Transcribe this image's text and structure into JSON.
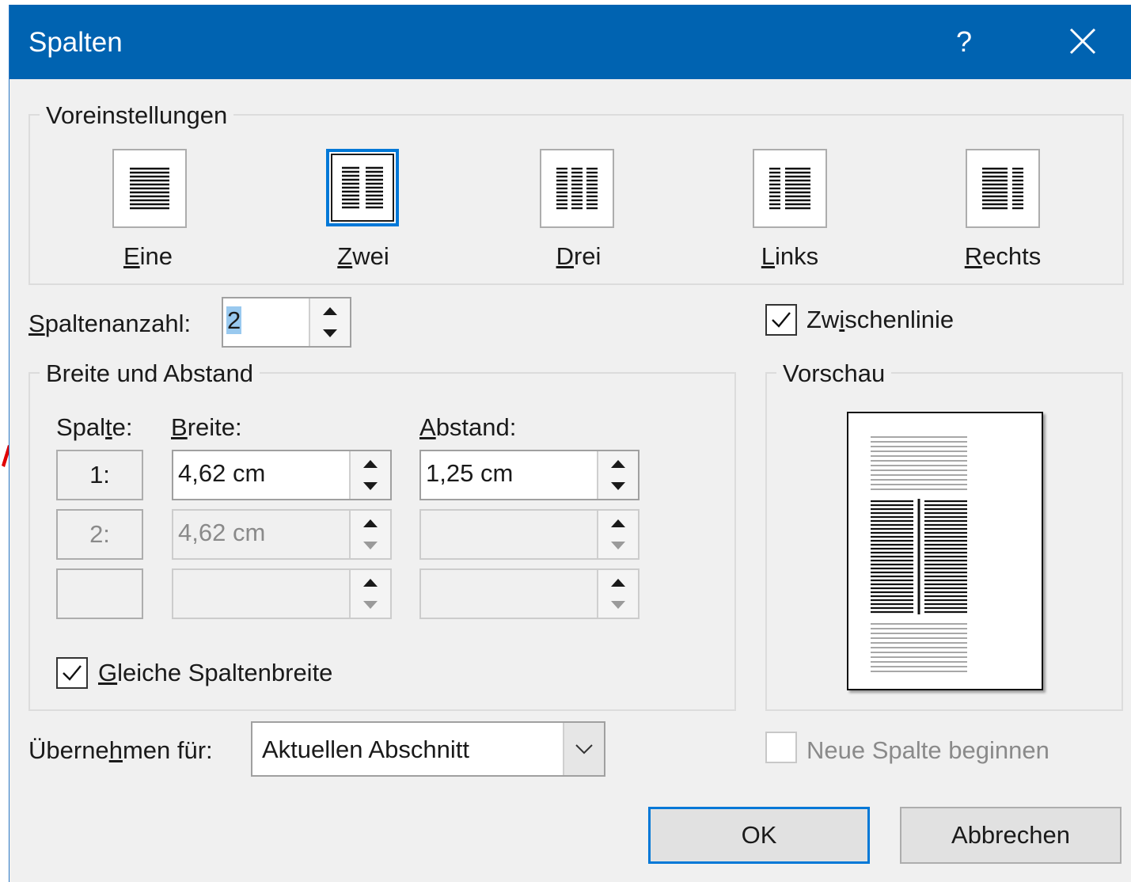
{
  "window": {
    "title": "Spalten",
    "help_label": "?"
  },
  "presets": {
    "group_label": "Voreinstellungen",
    "items": [
      {
        "label": "Eine",
        "access": "E",
        "rest": "ine",
        "icon": "one-column-icon"
      },
      {
        "label": "Zwei",
        "access": "Z",
        "rest": "wei",
        "icon": "two-columns-icon"
      },
      {
        "label": "Drei",
        "access": "D",
        "rest": "rei",
        "icon": "three-columns-icon"
      },
      {
        "label": "Links",
        "access": "L",
        "rest": "inks",
        "icon": "left-column-icon"
      },
      {
        "label": "Rechts",
        "access": "R",
        "rest": "echts",
        "icon": "right-column-icon"
      }
    ],
    "selected": "Zwei"
  },
  "column_count": {
    "pre": "",
    "access": "S",
    "post": "paltenanzahl:",
    "value": "2"
  },
  "line_between": {
    "pre": "Zw",
    "access": "i",
    "post": "schenlinie",
    "checked": true
  },
  "width_spacing": {
    "group_label": "Breite und Abstand",
    "col_header": {
      "pre": "Spal",
      "access": "t",
      "post": "e:"
    },
    "width_header": {
      "pre": "",
      "access": "B",
      "post": "reite:"
    },
    "spacing_header": {
      "pre": "",
      "access": "A",
      "post": "bstand:"
    },
    "rows": [
      {
        "col": "1:",
        "width": "4,62 cm",
        "spacing": "1,25 cm"
      },
      {
        "col": "2:",
        "width": "4,62 cm",
        "spacing": ""
      },
      {
        "col": "",
        "width": "",
        "spacing": ""
      }
    ],
    "equal_width": {
      "pre": "",
      "access": "G",
      "post": "leiche Spaltenbreite",
      "checked": true
    }
  },
  "preview": {
    "group_label": "Vorschau"
  },
  "apply_to": {
    "pre": "Überne",
    "access": "h",
    "post": "men für:",
    "value": "Aktuellen Abschnitt"
  },
  "new_column": {
    "label": "Neue Spalte beginnen",
    "checked": false
  },
  "buttons": {
    "ok": "OK",
    "cancel": "Abbrechen"
  },
  "colors": {
    "titlebar": "#0063b1",
    "accent": "#0078d7",
    "background": "#f0f0f0",
    "annotation_arrow": "#e00000"
  }
}
